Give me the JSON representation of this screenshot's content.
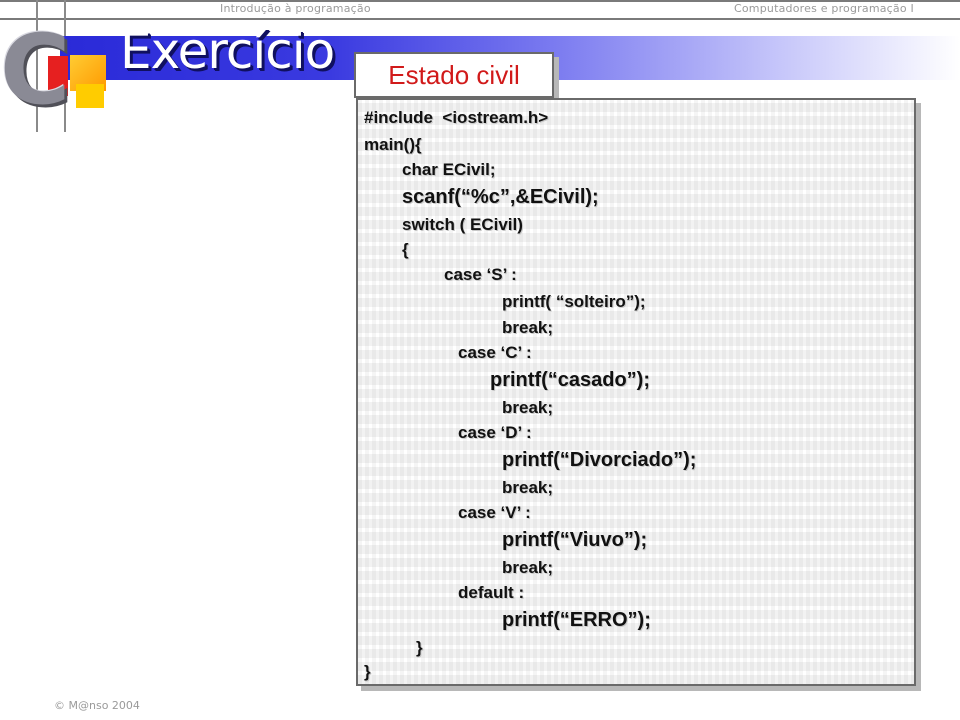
{
  "header": {
    "left_text": "Introdução à programação",
    "right_text": "Computadores e programação I"
  },
  "logo": {
    "letter": "C"
  },
  "slide": {
    "title": "Exercício",
    "subtitle": "Estado civil"
  },
  "code": {
    "lines": [
      "#include  <iostream.h>",
      "main(){",
      "char ECivil;",
      "scanf(“%c”,&ECivil);",
      "switch ( ECivil)",
      "{",
      "case ‘S’ :",
      "printf( “solteiro”);",
      "break;",
      "case ‘C’ :",
      "printf(“casado”);",
      "break;",
      "case ‘D’ :",
      "printf(“Divorciado”);",
      "break;",
      "case ‘V’ :",
      "printf(“Viuvo”);",
      "break;",
      "default :",
      "printf(“ERRO”);",
      "}",
      "}"
    ]
  },
  "footer": {
    "copyright": "© M@nso 2004"
  },
  "colors": {
    "title_band": "#2a2ad8",
    "subtitle_text": "#d11a1a",
    "code_text": "#111111"
  }
}
